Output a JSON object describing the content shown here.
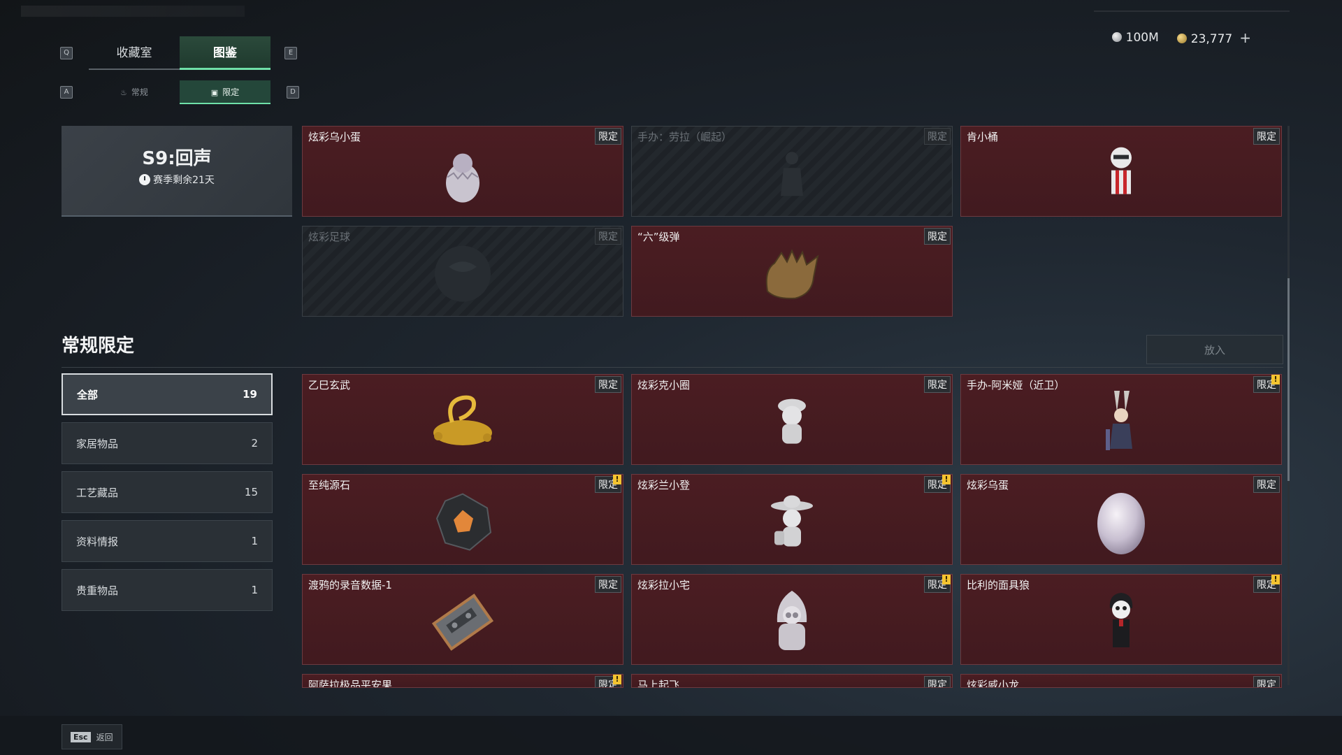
{
  "tabs": {
    "left_key": "Q",
    "right_key": "E",
    "items": [
      "收藏室",
      "图鉴"
    ]
  },
  "subtabs": {
    "left_key": "A",
    "right_key": "D",
    "items": [
      "常规",
      "限定"
    ]
  },
  "currency": {
    "silver": "100M",
    "gold": "23,777",
    "add_label": "+"
  },
  "season": {
    "title": "S9:回声",
    "remaining": "赛季剩余21天"
  },
  "top_items": [
    {
      "name": "炫彩乌小蛋",
      "tag": "限定"
    },
    {
      "name": "手办：劳拉（崛起）",
      "tag": "限定"
    },
    {
      "name": "肯小桶",
      "tag": "限定"
    },
    {
      "name": "炫彩足球",
      "tag": "限定"
    },
    {
      "name": "“六”级弹",
      "tag": "限定"
    }
  ],
  "section": {
    "title": "常规限定",
    "put_in_label": "放入"
  },
  "filters": [
    {
      "label": "全部",
      "count": "19"
    },
    {
      "label": "家居物品",
      "count": "2"
    },
    {
      "label": "工艺藏品",
      "count": "15"
    },
    {
      "label": "资料情报",
      "count": "1"
    },
    {
      "label": "贵重物品",
      "count": "1"
    }
  ],
  "items": [
    {
      "name": "乙巳玄武",
      "tag": "限定"
    },
    {
      "name": "炫彩克小圈",
      "tag": "限定"
    },
    {
      "name": "手办-阿米娅（近卫）",
      "tag": "限定",
      "alert": "!"
    },
    {
      "name": "至纯源石",
      "tag": "限定",
      "alert": "!"
    },
    {
      "name": "炫彩兰小登",
      "tag": "限定",
      "alert": "!"
    },
    {
      "name": "炫彩乌蛋",
      "tag": "限定"
    },
    {
      "name": "渡鸦的录音数据-1",
      "tag": "限定"
    },
    {
      "name": "炫彩拉小宅",
      "tag": "限定",
      "alert": "!"
    },
    {
      "name": "比利的面具狼",
      "tag": "限定",
      "alert": "!"
    },
    {
      "name": "阿萨拉极品平安果",
      "tag": "限定",
      "alert": "!"
    },
    {
      "name": "马上起飞",
      "tag": "限定"
    },
    {
      "name": "炫彩威小龙",
      "tag": "限定"
    }
  ],
  "footer": {
    "esc_key": "Esc",
    "back_label": "返回"
  }
}
